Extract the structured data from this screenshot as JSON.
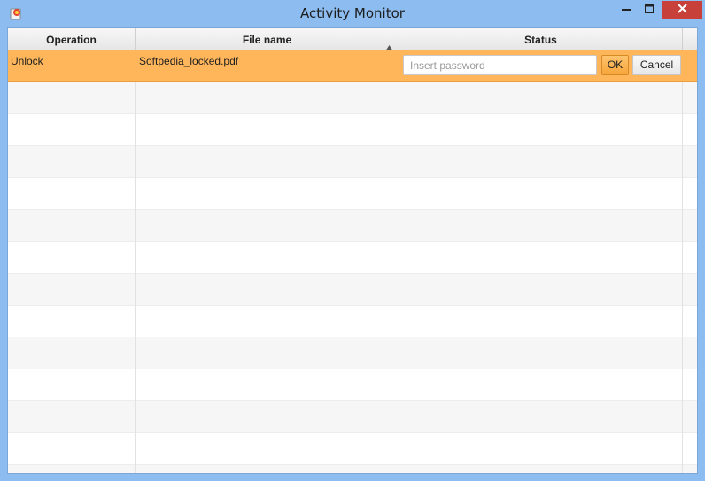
{
  "window": {
    "title": "Activity Monitor"
  },
  "table": {
    "columns": [
      "Operation",
      "File name",
      "Status"
    ],
    "sort": {
      "column": "File name",
      "direction": "ascending"
    },
    "rows": [
      {
        "operation": "Unlock",
        "file_name": "Softpedia_locked.pdf",
        "status": {
          "password_placeholder": "Insert password",
          "password_value": "",
          "ok_label": "OK",
          "cancel_label": "Cancel"
        },
        "selected": true
      }
    ]
  },
  "colors": {
    "selection": "#ffb65b",
    "close_button": "#c7403a",
    "title_bar": "#8dbdf0"
  }
}
